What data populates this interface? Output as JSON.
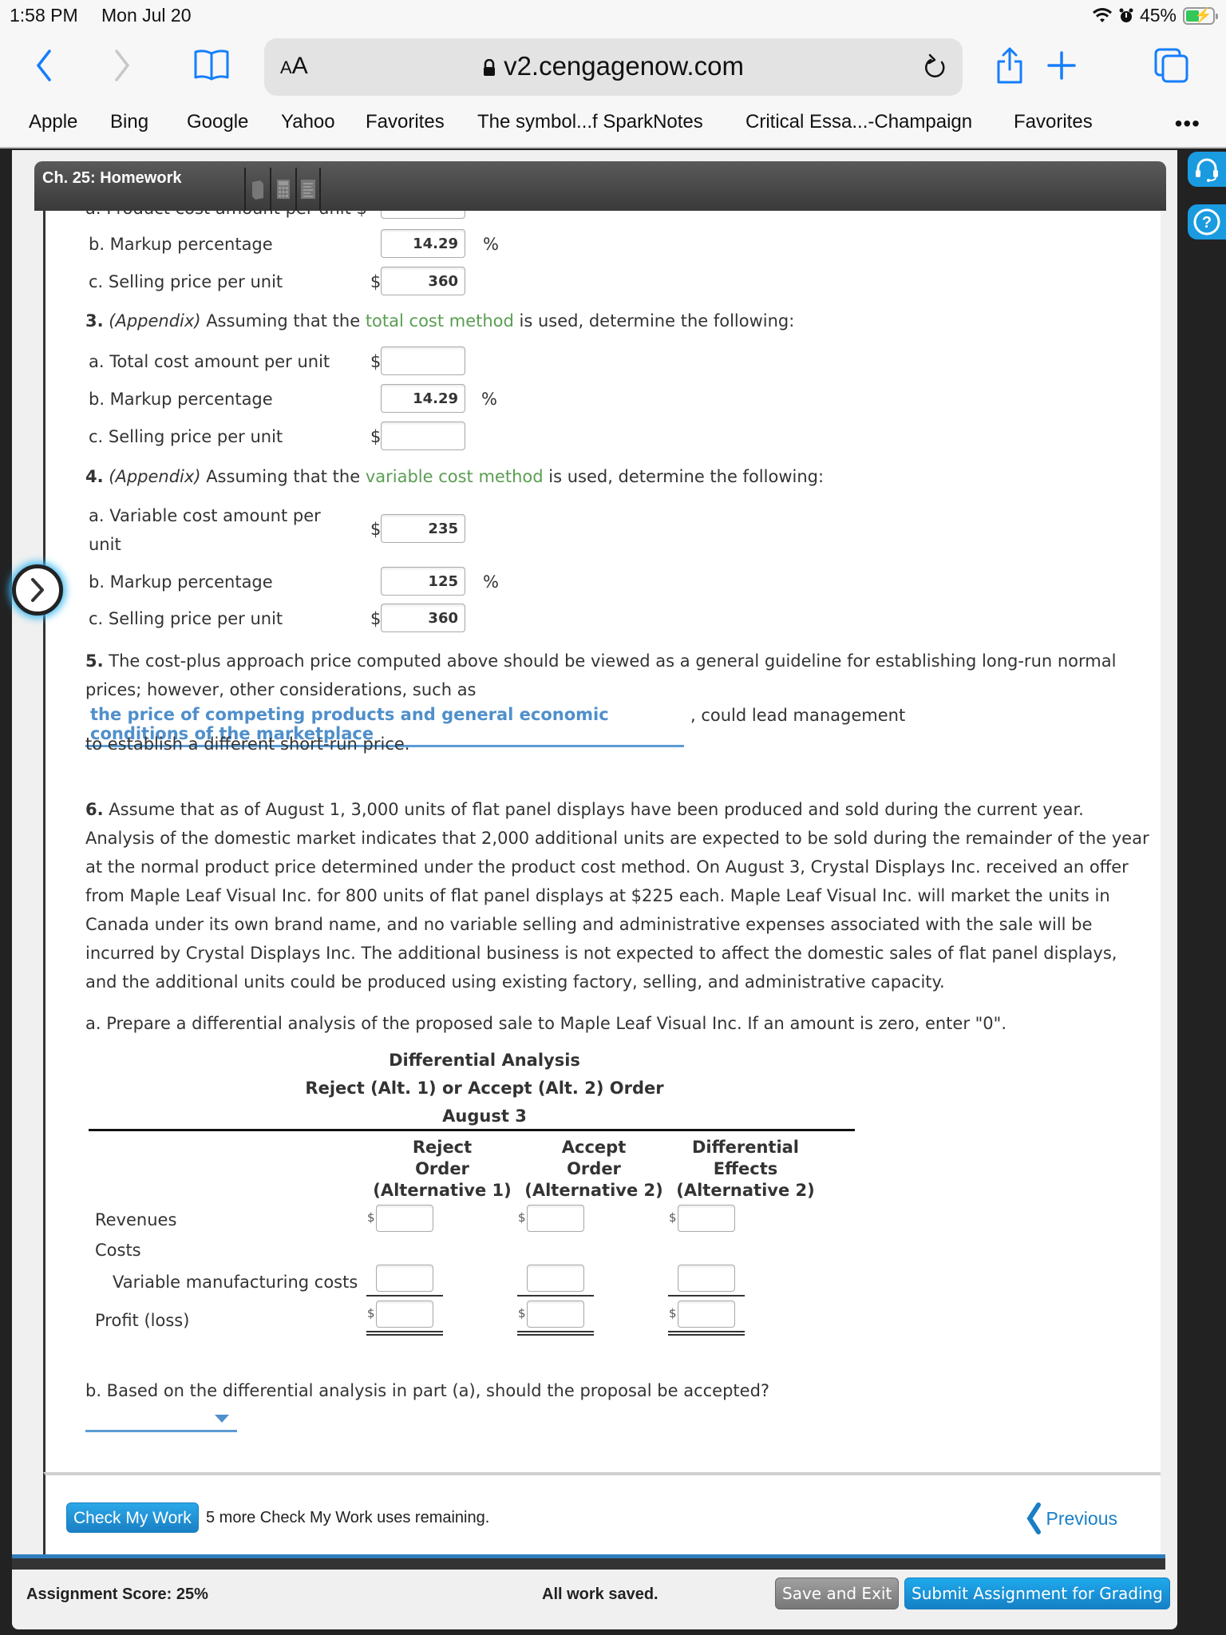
{
  "status_bar": {
    "time": "1:58 PM",
    "date": "Mon Jul 20",
    "battery": "45%"
  },
  "browser": {
    "aa_label_small": "A",
    "aa_label_big": "A",
    "url": "v2.cengagenow.com",
    "bookmarks": [
      "Apple",
      "Bing",
      "Google",
      "Yahoo",
      "Favorites",
      "The symbol...f SparkNotes",
      "Critical Essa...-Champaign",
      "Favorites"
    ],
    "more": "•••"
  },
  "assignment": {
    "title": "Ch. 25: Homework",
    "clipped_row": "a.  Product cost amount per unit  $"
  },
  "q2": {
    "b_label": "b.  Markup percentage",
    "b_value": "14.29",
    "b_unit": "%",
    "c_label": "c.  Selling price per unit",
    "c_value": "360",
    "c_prefix": "$"
  },
  "q3": {
    "num": "3.",
    "appendix": "(Appendix)",
    "pre": " Assuming that the ",
    "method": "total cost method",
    "post": " is used, determine the following:",
    "a_label": "a.  Total cost amount per unit",
    "a_value": "",
    "a_prefix": "$",
    "b_label": "b.  Markup percentage",
    "b_value": "14.29",
    "b_unit": "%",
    "c_label": "c.  Selling price per unit",
    "c_value": "",
    "c_prefix": "$"
  },
  "q4": {
    "num": "4.",
    "appendix": "(Appendix)",
    "pre": " Assuming that the ",
    "method": "variable cost method",
    "post": " is used, determine the following:",
    "a_label_1": "a.  Variable cost amount per",
    "a_label_2": "unit",
    "a_value": "235",
    "a_prefix": "$",
    "b_label": "b.  Markup percentage",
    "b_value": "125",
    "b_unit": "%",
    "c_label": "c.  Selling price per unit",
    "c_value": "360",
    "c_prefix": "$"
  },
  "q5": {
    "num": "5.",
    "line1": " The cost-plus approach price computed above should be viewed as a general guideline for establishing long-run normal",
    "line2": "prices; however, other considerations, such as",
    "selected_answer": "the price of competing products and general economic conditions of the marketplace",
    "line3_after": ", could lead management",
    "line4": "to establish a different short-run price."
  },
  "q6": {
    "num": "6.",
    "lines": [
      " Assume that as of August 1, 3,000 units of flat panel displays have been produced and sold during the current year.",
      "Analysis of the domestic market indicates that 2,000 additional units are expected to be sold during the remainder of the year",
      "at the normal product price determined under the product cost method. On August 3, Crystal Displays Inc. received an offer",
      "from Maple Leaf Visual Inc. for 800 units of flat panel displays at $225 each. Maple Leaf Visual Inc. will market the units in",
      "Canada under its own brand name, and no variable selling and administrative expenses associated with the sale will be",
      "incurred by Crystal Displays Inc. The additional business is not expected to affect the domestic sales of flat panel displays,",
      "and the additional units could be produced using existing factory, selling, and administrative capacity."
    ],
    "part_a": "a.  Prepare a differential analysis of the proposed sale to Maple Leaf Visual Inc. If an amount is zero, enter \"0\".",
    "table": {
      "title1": "Differential Analysis",
      "title2": "Reject (Alt. 1) or Accept (Alt. 2) Order",
      "title3": "August 3",
      "columns": [
        {
          "l1": "Reject",
          "l2": "Order",
          "l3": "(Alternative 1)"
        },
        {
          "l1": "Accept",
          "l2": "Order",
          "l3": "(Alternative 2)"
        },
        {
          "l1": "Differential",
          "l2": "Effects",
          "l3": "(Alternative 2)"
        }
      ],
      "rows": {
        "revenues": {
          "label": "Revenues",
          "values": [
            "",
            "",
            ""
          ],
          "prefix": "$"
        },
        "costs": {
          "label": "Costs"
        },
        "variable": {
          "label": "Variable manufacturing costs",
          "values": [
            "",
            "",
            ""
          ]
        },
        "profit": {
          "label": "Profit (loss)",
          "values": [
            "",
            "",
            ""
          ],
          "prefix": "$"
        }
      }
    },
    "part_b": "b.  Based on the differential analysis in part (a), should the proposal be accepted?",
    "part_b_selected": ""
  },
  "bottom": {
    "check_button": "Check My Work",
    "check_message": "5 more Check My Work uses remaining.",
    "previous": "Previous"
  },
  "footer": {
    "score": "Assignment Score: 25%",
    "saved": "All work saved.",
    "save_exit": "Save and Exit",
    "submit": "Submit Assignment for Grading"
  },
  "colors": {
    "accent": "#157efb",
    "link_green": "#5a9e52",
    "answer_blue": "#4f8fcb",
    "button_blue": "#1a9be0"
  }
}
